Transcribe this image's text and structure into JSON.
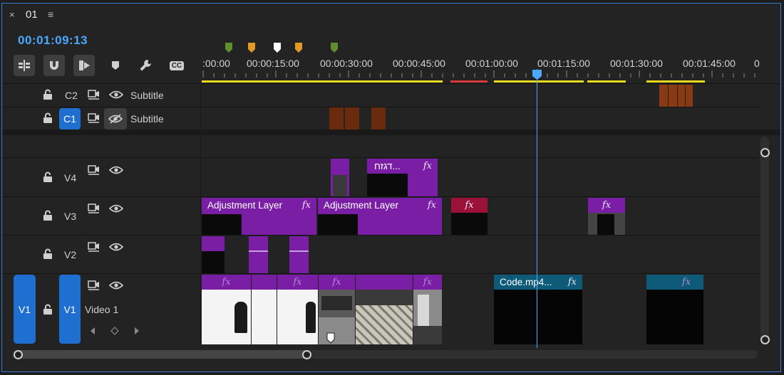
{
  "tab": {
    "close": "×",
    "title": "01",
    "menu": "≡"
  },
  "timecode": "00:01:09:13",
  "tools": [
    {
      "name": "insert-sequence-as-nest-icon"
    },
    {
      "name": "snap-magnet-icon"
    },
    {
      "name": "linked-selection-icon"
    },
    {
      "name": "add-marker-icon"
    },
    {
      "name": "wrench-settings-icon"
    },
    {
      "name": "captions-cc-icon",
      "text": "CC"
    }
  ],
  "ruler": {
    "labels": [
      ":00:00",
      "00:00:15:00",
      "00:00:30:00",
      "00:00:45:00",
      "00:01:00:00",
      "00:01:15:00",
      "00:01:30:00",
      "00:01:45:00",
      "0"
    ],
    "marker_colors": [
      "#5f8f2e",
      "#e09a27",
      "#ffffff",
      "#e09a27",
      "#5f8f2e"
    ],
    "render_bar_colors": {
      "rendered": "#e8d81e",
      "unrendered": "#d43a3a"
    }
  },
  "tracks": {
    "C2": {
      "label": "C2",
      "name": "Subtitle"
    },
    "C1": {
      "label": "C1",
      "name": "Subtitle"
    },
    "V4": {
      "label": "V4"
    },
    "V3": {
      "label": "V3"
    },
    "V2": {
      "label": "V2"
    },
    "V1": {
      "source": "V1",
      "label": "V1",
      "name": "Video 1"
    }
  },
  "clips": {
    "v4_title": "דגזח...",
    "adj1": "Adjustment Layer",
    "adj2": "Adjustment Layer",
    "code": "Code.mp4...",
    "fx": "fx"
  },
  "colors": {
    "accent": "#1e6fd0",
    "playhead": "#4aa8ff",
    "clip_purple": "#7a1ea6",
    "clip_teal": "#0d5b78",
    "caption_orange": "#8a3a12"
  }
}
